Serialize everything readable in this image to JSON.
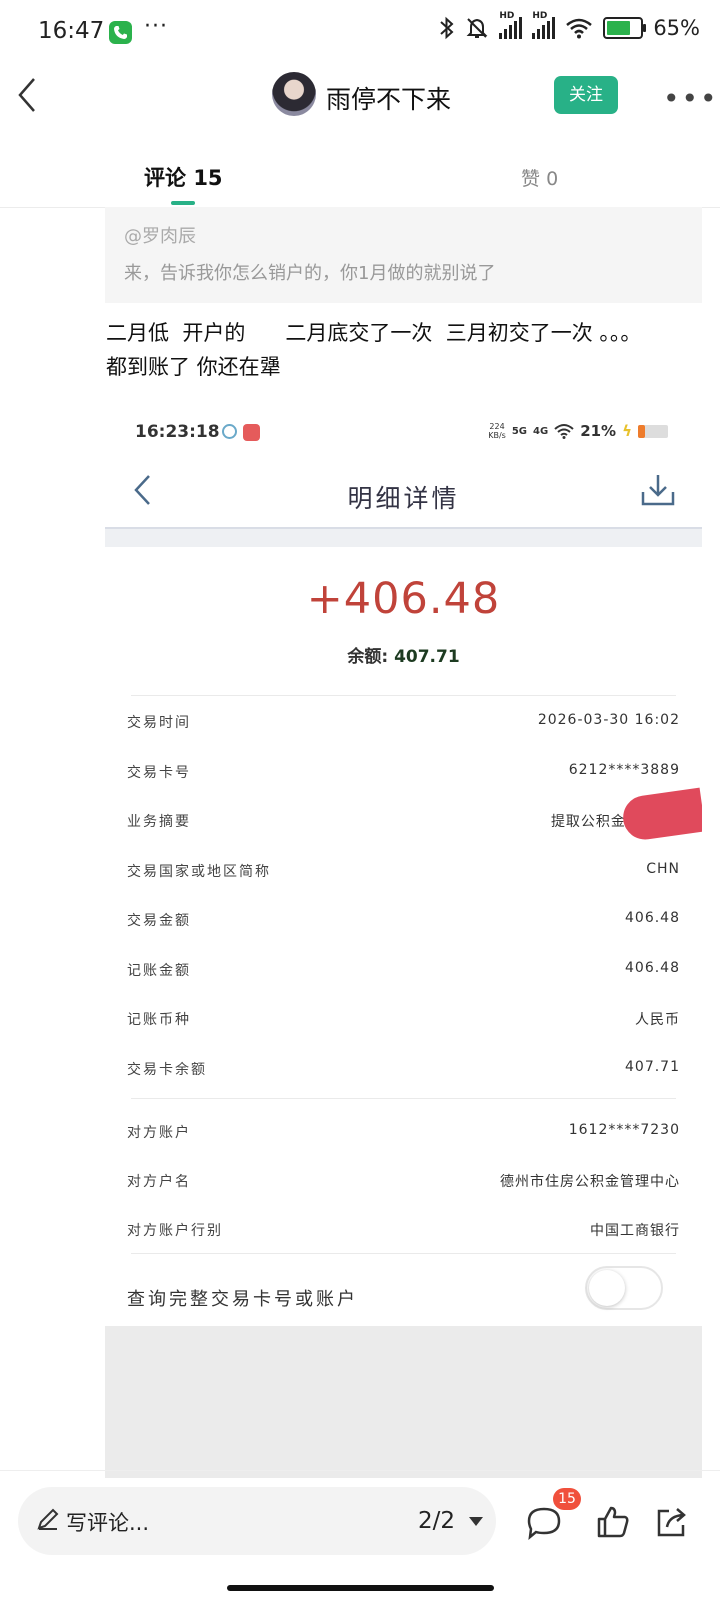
{
  "status_bar": {
    "time": "16:47",
    "dots": "···",
    "battery": "65%",
    "hd1": "HD",
    "hd2": "HD"
  },
  "header": {
    "nickname": "雨停不下来",
    "follow_label": "关注"
  },
  "tabs": {
    "comments_label": "评论",
    "comments_count": "15",
    "likes_label": "赞",
    "likes_count": "0"
  },
  "quote": {
    "user": "@罗肉辰",
    "text": "来，告诉我你怎么销户的，你1月做的就别说了"
  },
  "comment": {
    "line1": "二月低  开户的      二月底交了一次  三月初交了一次 。。。",
    "line2": "都到账了 你还在犟"
  },
  "embedded": {
    "status_time": "16:23:18",
    "net_speed": "224",
    "net_unit": "KB/s",
    "net_5g": "5G",
    "net_4g": "4G",
    "battery": "21%",
    "title": "明细详情",
    "amount": "+406.48",
    "balance_label": "余额:",
    "balance_value": "407.71",
    "rows": [
      {
        "label": "交易时间",
        "value": "2026-03-30 16:02"
      },
      {
        "label": "交易卡号",
        "value": "6212****3889"
      },
      {
        "label": "业务摘要",
        "value": "提取公积金-"
      },
      {
        "label": "交易国家或地区简称",
        "value": "CHN"
      },
      {
        "label": "交易金额",
        "value": "406.48"
      },
      {
        "label": "记账金额",
        "value": "406.48"
      },
      {
        "label": "记账币种",
        "value": "人民币"
      },
      {
        "label": "交易卡余额",
        "value": "407.71"
      },
      {
        "label": "对方账户",
        "value": "1612****7230"
      },
      {
        "label": "对方户名",
        "value": "德州市住房公积金管理中心"
      },
      {
        "label": "对方账户行别",
        "value": "中国工商银行"
      }
    ],
    "toggle_label": "查询完整交易卡号或账户",
    "toggle_on": false
  },
  "bottom_bar": {
    "placeholder": "写评论...",
    "page": "2/2",
    "comment_badge": "15"
  },
  "colors": {
    "accent": "#28b187",
    "amount": "#c0433a",
    "badge": "#f0503c"
  },
  "icons": [
    "back-icon",
    "more-icon",
    "phone-icon",
    "bluetooth-icon",
    "mute-icon",
    "wifi-icon",
    "battery-icon",
    "download-icon",
    "pen-icon",
    "comment-icon",
    "like-icon",
    "share-icon"
  ]
}
